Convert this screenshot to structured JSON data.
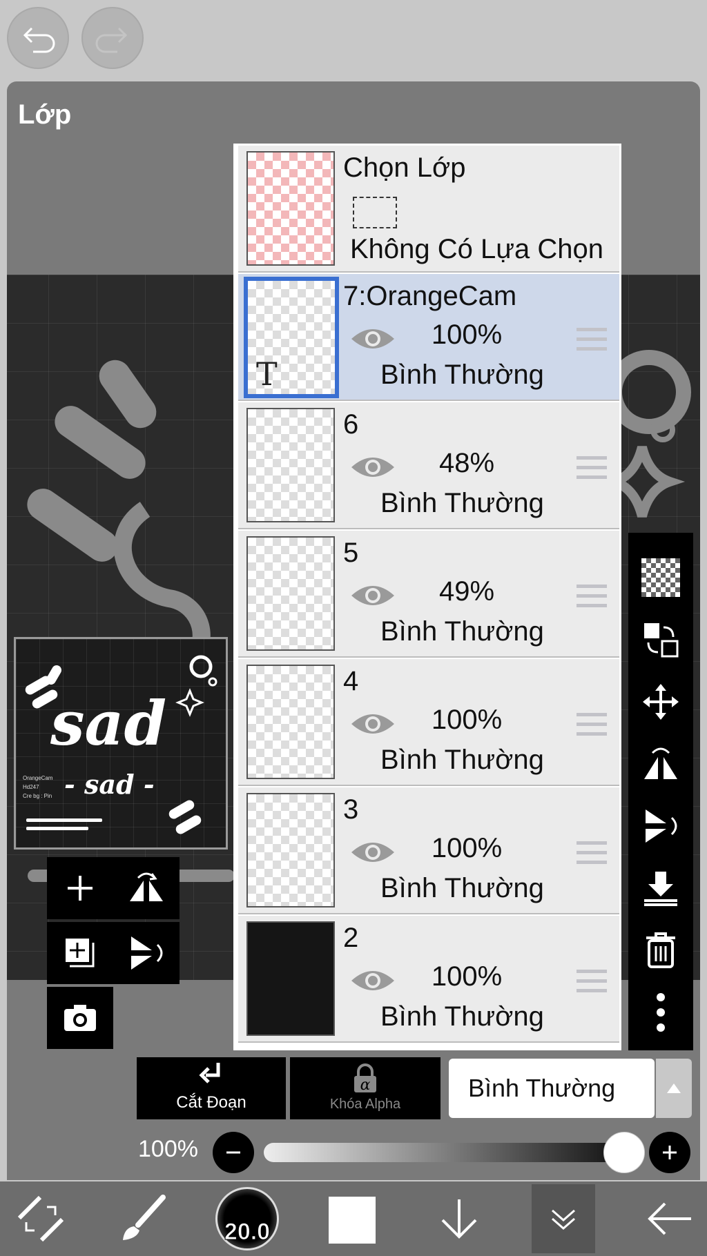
{
  "panel": {
    "title": "Lớp"
  },
  "selection_row": {
    "title": "Chọn Lớp",
    "status": "Không Có Lựa Chọn"
  },
  "layers": [
    {
      "name": "7:OrangeCam",
      "opacity": "100%",
      "blend": "Bình Thường",
      "selected": true,
      "type_icon": "T"
    },
    {
      "name": "6",
      "opacity": "48%",
      "blend": "Bình Thường",
      "selected": false
    },
    {
      "name": "5",
      "opacity": "49%",
      "blend": "Bình Thường",
      "selected": false
    },
    {
      "name": "4",
      "opacity": "100%",
      "blend": "Bình Thường",
      "selected": false
    },
    {
      "name": "3",
      "opacity": "100%",
      "blend": "Bình Thường",
      "selected": false
    },
    {
      "name": "2",
      "opacity": "100%",
      "blend": "Bình Thường",
      "selected": false
    }
  ],
  "preview": {
    "big_text": "sad",
    "small_text": "- sad -",
    "credits": [
      "OrangeCam",
      "Hd247",
      "Cre bg : Pin"
    ]
  },
  "actions": {
    "clip_label": "Cắt Đoạn",
    "alpha_lock_label": "Khóa Alpha",
    "blend_mode": "Bình Thường"
  },
  "opacity_slider": {
    "label": "100%",
    "value": 1.0
  },
  "bottom_bar": {
    "brush_size": "20.0"
  },
  "colors": {
    "panel_bg": "#7a7a7a",
    "selected_row": "#ced8ea",
    "selected_border": "#3a6fd1",
    "toolbar_bg": "#6d6d6d"
  },
  "icons": {
    "top": [
      "undo-icon",
      "redo-icon"
    ],
    "right_tools": [
      "transparency-icon",
      "swap-layer-icon",
      "move-icon",
      "flip-horizontal-icon",
      "flip-vertical-icon",
      "merge-down-icon",
      "trash-icon",
      "more-icon"
    ],
    "left_tools": [
      "add-layer-icon",
      "flip-h-icon",
      "add-copy-layer-icon",
      "flip-v-icon",
      "camera-icon"
    ],
    "bottom": [
      "transform-icon",
      "brush-icon",
      "brush-size-icon",
      "color-icon",
      "down-arrow-icon",
      "layer-panel-icon",
      "back-icon"
    ]
  }
}
